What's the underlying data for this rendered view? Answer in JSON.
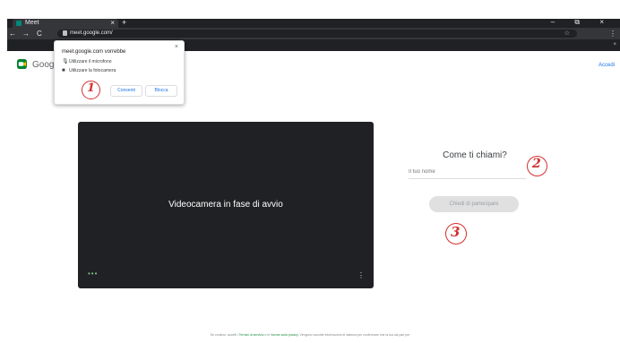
{
  "browser": {
    "tab_title": "Meet",
    "tab_close": "×",
    "new_tab": "+",
    "window_controls": "–   ⧉   ×",
    "nav": {
      "back": "←",
      "forward": "→",
      "reload": "C"
    },
    "url": "meet.google.com/",
    "star": "☆",
    "menu": "⋮",
    "secondary_close": "×"
  },
  "meet": {
    "logo_text": "Goog",
    "signin": "Accedi",
    "brand_colors": [
      "#00832d",
      "#0066da",
      "#e94235",
      "#2684fc",
      "#00ac47",
      "#ffba00"
    ]
  },
  "permission_popup": {
    "title": "meet.google.com vorrebbe",
    "close": "×",
    "items": [
      {
        "icon": "microphone-icon",
        "glyph": "🎙",
        "label": "Utilizzare il microfono"
      },
      {
        "icon": "camera-icon",
        "glyph": "■",
        "label": "Utilizzare la fotocamera"
      }
    ],
    "allow_label": "Consenti",
    "block_label": "Blocca"
  },
  "annotations": {
    "one": "1",
    "two": "2",
    "three": "3"
  },
  "video": {
    "status": "Videocamera in fase di avvio",
    "dots": "•••",
    "more": "⋮"
  },
  "join": {
    "heading": "Come ti chiami?",
    "name_placeholder": "Il tuo nome",
    "join_label": "Chiedi di partecipare"
  },
  "footer": {
    "prefix": "Se continui, accetti i ",
    "terms": "Termini di servizio",
    "middle": " e le ",
    "privacy": "Norme sulla privacy",
    "suffix": ". Vengono raccolte informazioni di sistema per confermare che la tua sia pari per"
  }
}
